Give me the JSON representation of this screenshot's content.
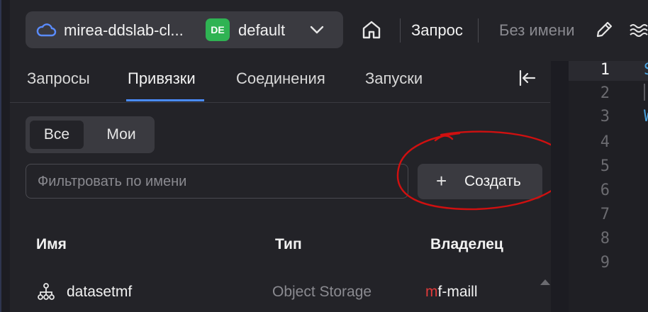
{
  "header": {
    "project_name": "mirea-ddslab-cl...",
    "env_badge": "DE",
    "env_name": "default",
    "query_label": "Запрос",
    "query_name_placeholder": "Без имени"
  },
  "tabs": [
    {
      "label": "Запросы",
      "active": false
    },
    {
      "label": "Привязки",
      "active": true
    },
    {
      "label": "Соединения",
      "active": false
    },
    {
      "label": "Запуски",
      "active": false
    }
  ],
  "segmented": {
    "all": "Все",
    "mine": "Мои",
    "selected": "Все"
  },
  "filter": {
    "placeholder": "Фильтровать по имени",
    "value": ""
  },
  "create_button": {
    "label": "Создать"
  },
  "table": {
    "headers": {
      "name": "Имя",
      "type": "Тип",
      "owner": "Владелец"
    },
    "rows": [
      {
        "name": "datasetmf",
        "type": "Object Storage",
        "owner_first": "m",
        "owner_rest": "f-maill"
      }
    ]
  },
  "editor": {
    "line_numbers": [
      "1",
      "2",
      "3",
      "4",
      "5",
      "6",
      "7",
      "8",
      "9"
    ],
    "current_line": 1,
    "code_glyphs": [
      "S",
      "W"
    ]
  },
  "colors": {
    "accent": "#4a8cff",
    "badge_green": "#2fb353",
    "annotation_red": "#d01010",
    "background": "#232328"
  },
  "icons": [
    "cloud-icon",
    "chevron-down-icon",
    "home-icon",
    "pencil-icon",
    "waves-icon",
    "collapse-panel-icon",
    "plus-icon",
    "tree-icon",
    "scroll-up-icon"
  ]
}
